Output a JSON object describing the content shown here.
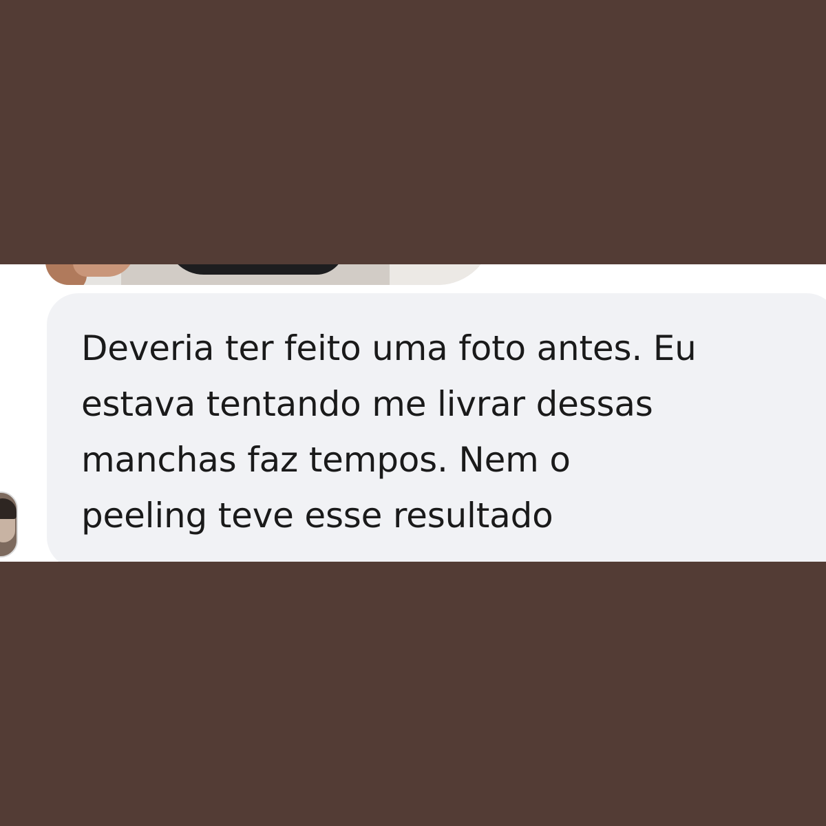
{
  "message": {
    "lines": [
      "Deveria ter feito uma foto antes. Eu",
      "estava tentando me livrar dessas",
      "manchas faz tempos. Nem o",
      "peeling teve esse resultado"
    ]
  },
  "colors": {
    "background": "#533c35",
    "chat_background": "#ffffff",
    "bubble": "#f1f2f5",
    "text": "#1a1a1a"
  }
}
